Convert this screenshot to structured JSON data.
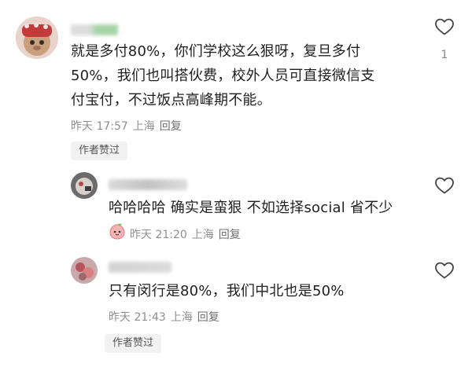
{
  "comments": [
    {
      "text_lines": [
        "就是多付80%，你们学校这么狠呀，复旦多付",
        "50%，我们也叫搭伙费，校外人员可直接微信支",
        "付宝付，不过饭点高峰期不能。"
      ],
      "time": "昨天 17:57",
      "location": "上海",
      "reply_label": "回复",
      "author_badge": "作者赞过",
      "like_count": "1"
    }
  ],
  "replies": [
    {
      "text": "哈哈哈哈 确实是蛮狠 不如选择social 省不少",
      "time": "昨天 21:20",
      "location": "上海",
      "reply_label": "回复",
      "like_count": ""
    },
    {
      "text": "只有闵行是80%，我们中北也是50%",
      "time": "昨天 21:43",
      "location": "上海",
      "reply_label": "回复",
      "author_badge": "作者赞过",
      "like_count": ""
    }
  ],
  "colors": {
    "text": "#1f1f1f",
    "meta": "#8f8f8f",
    "badge_bg": "#f2f2f2",
    "icon": "#444444"
  }
}
